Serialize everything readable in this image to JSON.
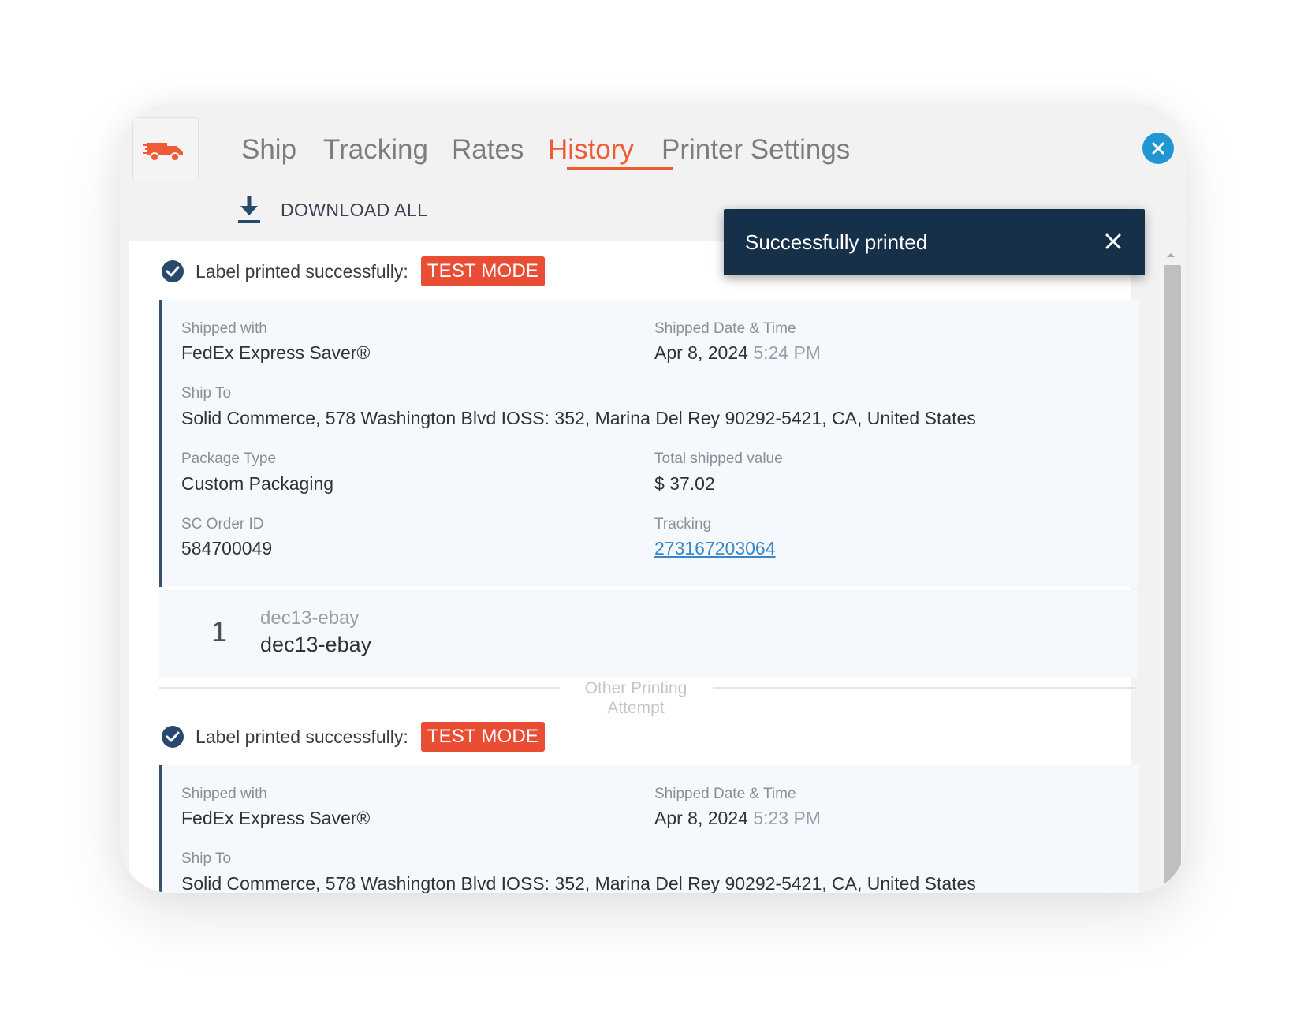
{
  "nav": {
    "tabs": [
      {
        "label": "Ship"
      },
      {
        "label": "Tracking"
      },
      {
        "label": "Rates"
      },
      {
        "label": "History"
      },
      {
        "label": "Printer Settings"
      }
    ],
    "active_tab": "History"
  },
  "toolbar": {
    "download_all": "DOWNLOAD ALL"
  },
  "toast": {
    "message": "Successfully printed"
  },
  "records": [
    {
      "status": "Label printed successfully:",
      "badge": "TEST MODE",
      "shipped_with_label": "Shipped with",
      "shipped_with": "FedEx Express Saver®",
      "date_label": "Shipped Date & Time",
      "date": "Apr 8, 2024",
      "time": "5:24 PM",
      "ship_to_label": "Ship To",
      "ship_to": "Solid Commerce, 578 Washington Blvd IOSS: 352, Marina Del Rey 90292-5421, CA, United States",
      "package_type_label": "Package Type",
      "package_type": "Custom Packaging",
      "total_label": "Total shipped value",
      "total": "$ 37.02",
      "order_id_label": "SC Order ID",
      "order_id": "584700049",
      "tracking_label": "Tracking",
      "tracking": "273167203064",
      "item": {
        "qty": "1",
        "sku": "dec13-ebay",
        "title": "dec13-ebay"
      }
    },
    {
      "status": "Label printed successfully:",
      "badge": "TEST MODE",
      "shipped_with_label": "Shipped with",
      "shipped_with": "FedEx Express Saver®",
      "date_label": "Shipped Date & Time",
      "date": "Apr 8, 2024",
      "time": "5:23 PM",
      "ship_to_label": "Ship To",
      "ship_to": "Solid Commerce, 578 Washington Blvd IOSS: 352, Marina Del Rey 90292-5421, CA, United States"
    }
  ],
  "divider": {
    "line1": "Other Printing",
    "line2": "Attempt"
  },
  "colors": {
    "accent": "#ee5b35",
    "badge": "#e94e35",
    "toast_bg": "#16304a",
    "close_button": "#2196d3",
    "check": "#27496b",
    "link": "#3a86c8"
  },
  "icons": {
    "logo": "truck-logo-icon",
    "close": "close-icon",
    "download": "download-icon",
    "status": "check-circle-icon",
    "toast_close": "close-icon",
    "scroll": "chevron-up-icon"
  }
}
